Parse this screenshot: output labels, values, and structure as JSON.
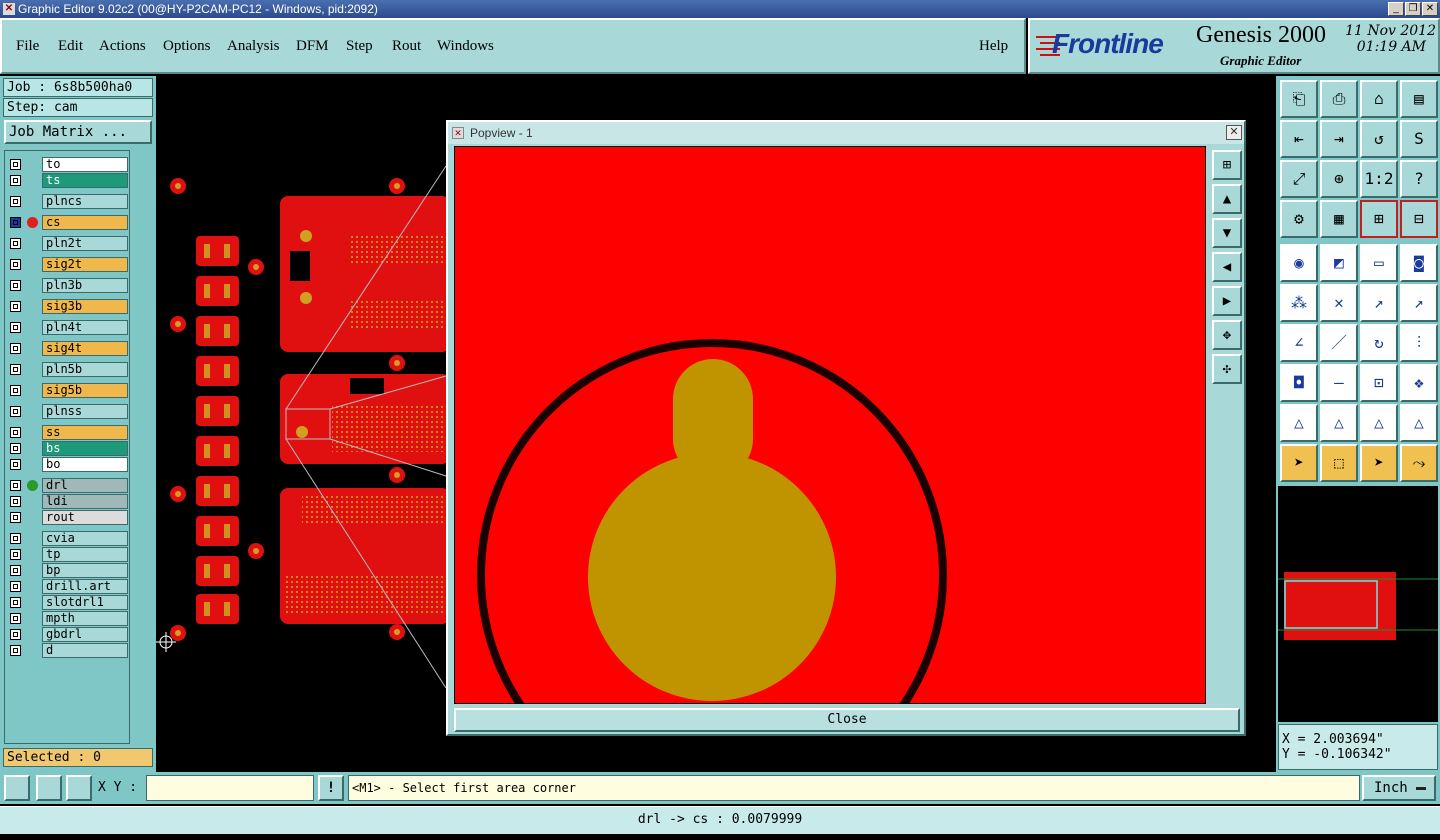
{
  "window": {
    "title": "Graphic Editor 9.02c2 (00@HY-P2CAM-PC12 - Windows, pid:2092)"
  },
  "menu": {
    "items": [
      "File",
      "Edit",
      "Actions",
      "Options",
      "Analysis",
      "DFM",
      "Step",
      "Rout",
      "Windows"
    ],
    "help": "Help"
  },
  "brand": {
    "logo": "Frontline",
    "product": "Genesis 2000",
    "subtitle": "Graphic Editor",
    "date": "11 Nov 2012",
    "time": "01:19 AM"
  },
  "job": {
    "job_label": "Job : 6s8b500ha0",
    "step_label": "Step: cam",
    "matrix_button": "Job Matrix ..."
  },
  "layers": [
    {
      "name": "to",
      "color": "#ffffff",
      "dot": ""
    },
    {
      "name": "ts",
      "color": "#1e9a7a",
      "dot": ""
    },
    {
      "name": "plncs",
      "color": "#a8d8d8",
      "dot": ""
    },
    {
      "name": "cs",
      "color": "#f0b84a",
      "dot": "#e02020"
    },
    {
      "name": "pln2t",
      "color": "#a8d8d8",
      "dot": ""
    },
    {
      "name": "sig2t",
      "color": "#f0b84a",
      "dot": ""
    },
    {
      "name": "pln3b",
      "color": "#a8d8d8",
      "dot": ""
    },
    {
      "name": "sig3b",
      "color": "#f0b84a",
      "dot": ""
    },
    {
      "name": "pln4t",
      "color": "#a8d8d8",
      "dot": ""
    },
    {
      "name": "sig4t",
      "color": "#f0b84a",
      "dot": ""
    },
    {
      "name": "pln5b",
      "color": "#a8d8d8",
      "dot": ""
    },
    {
      "name": "sig5b",
      "color": "#f0b84a",
      "dot": ""
    },
    {
      "name": "plnss",
      "color": "#a8d8d8",
      "dot": ""
    },
    {
      "name": "ss",
      "color": "#f0b84a",
      "dot": ""
    },
    {
      "name": "bs",
      "color": "#1e9a7a",
      "dot": ""
    },
    {
      "name": "bo",
      "color": "#ffffff",
      "dot": ""
    },
    {
      "name": "drl",
      "color": "#a0b8b8",
      "dot": "#2a9a2a"
    },
    {
      "name": "ldi",
      "color": "#a0b8b8",
      "dot": ""
    },
    {
      "name": "rout",
      "color": "#dcdcdc",
      "dot": ""
    },
    {
      "name": "cvia",
      "color": "#a8d8d8",
      "dot": ""
    },
    {
      "name": "tp",
      "color": "#a8d8d8",
      "dot": ""
    },
    {
      "name": "bp",
      "color": "#a8d8d8",
      "dot": ""
    },
    {
      "name": "drill.art",
      "color": "#a8d8d8",
      "dot": ""
    },
    {
      "name": "slotdrl1",
      "color": "#a8d8d8",
      "dot": ""
    },
    {
      "name": "mpth",
      "color": "#a8d8d8",
      "dot": ""
    },
    {
      "name": "gbdrl",
      "color": "#a8d8d8",
      "dot": ""
    },
    {
      "name": "d",
      "color": "#a8d8d8",
      "dot": ""
    }
  ],
  "selected": "Selected : 0",
  "popview": {
    "title": "Popview - 1",
    "close_button": "Close"
  },
  "coords": {
    "x": "X = 2.003694\"",
    "y": "Y = -0.106342\""
  },
  "cmd": {
    "xy_label": "X Y :",
    "xy_value": "",
    "prompt": "<M1> - Select first area corner",
    "units": "Inch"
  },
  "status": "drl -> cs : 0.0079999",
  "colors": {
    "teal": "#a8d8d8",
    "copper": "#ff0000",
    "pad": "#c09400"
  }
}
